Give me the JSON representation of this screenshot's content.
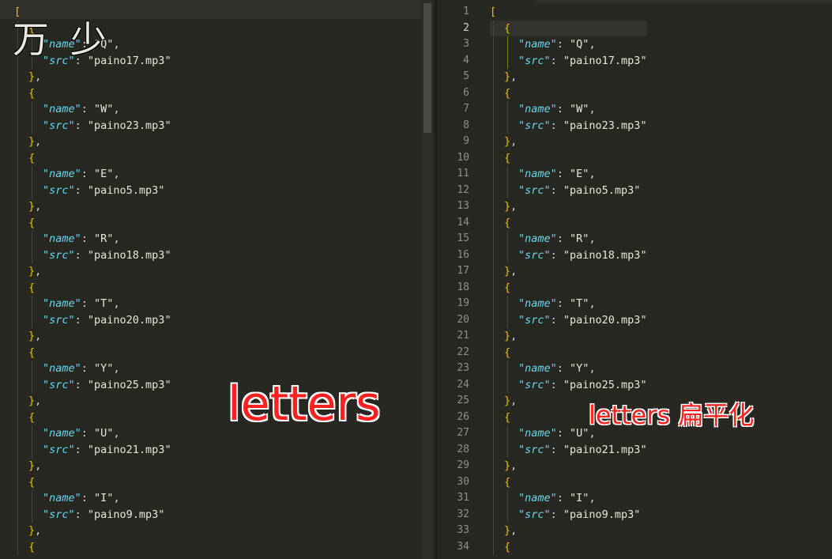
{
  "left_editor": {
    "watermark": "万 少",
    "caption": "letters",
    "lines": [
      {
        "type": "open_array",
        "indent": 0
      },
      {
        "type": "open_obj",
        "indent": 1
      },
      {
        "type": "prop",
        "indent": 2,
        "key": "name",
        "value": "Q",
        "comma": true
      },
      {
        "type": "prop",
        "indent": 2,
        "key": "src",
        "value": "paino17.mp3",
        "comma": false
      },
      {
        "type": "close_obj",
        "indent": 1,
        "comma": true
      },
      {
        "type": "open_obj",
        "indent": 1
      },
      {
        "type": "prop",
        "indent": 2,
        "key": "name",
        "value": "W",
        "comma": true
      },
      {
        "type": "prop",
        "indent": 2,
        "key": "src",
        "value": "paino23.mp3",
        "comma": false
      },
      {
        "type": "close_obj",
        "indent": 1,
        "comma": true
      },
      {
        "type": "open_obj",
        "indent": 1
      },
      {
        "type": "prop",
        "indent": 2,
        "key": "name",
        "value": "E",
        "comma": true
      },
      {
        "type": "prop",
        "indent": 2,
        "key": "src",
        "value": "paino5.mp3",
        "comma": false
      },
      {
        "type": "close_obj",
        "indent": 1,
        "comma": true
      },
      {
        "type": "open_obj",
        "indent": 1
      },
      {
        "type": "prop",
        "indent": 2,
        "key": "name",
        "value": "R",
        "comma": true
      },
      {
        "type": "prop",
        "indent": 2,
        "key": "src",
        "value": "paino18.mp3",
        "comma": false
      },
      {
        "type": "close_obj",
        "indent": 1,
        "comma": true
      },
      {
        "type": "open_obj",
        "indent": 1
      },
      {
        "type": "prop",
        "indent": 2,
        "key": "name",
        "value": "T",
        "comma": true
      },
      {
        "type": "prop",
        "indent": 2,
        "key": "src",
        "value": "paino20.mp3",
        "comma": false
      },
      {
        "type": "close_obj",
        "indent": 1,
        "comma": true
      },
      {
        "type": "open_obj",
        "indent": 1
      },
      {
        "type": "prop",
        "indent": 2,
        "key": "name",
        "value": "Y",
        "comma": true
      },
      {
        "type": "prop",
        "indent": 2,
        "key": "src",
        "value": "paino25.mp3",
        "comma": false
      },
      {
        "type": "close_obj",
        "indent": 1,
        "comma": true
      },
      {
        "type": "open_obj",
        "indent": 1
      },
      {
        "type": "prop",
        "indent": 2,
        "key": "name",
        "value": "U",
        "comma": true
      },
      {
        "type": "prop",
        "indent": 2,
        "key": "src",
        "value": "paino21.mp3",
        "comma": false
      },
      {
        "type": "close_obj",
        "indent": 1,
        "comma": true
      },
      {
        "type": "open_obj",
        "indent": 1
      },
      {
        "type": "prop",
        "indent": 2,
        "key": "name",
        "value": "I",
        "comma": true
      },
      {
        "type": "prop",
        "indent": 2,
        "key": "src",
        "value": "paino9.mp3",
        "comma": false
      },
      {
        "type": "close_obj",
        "indent": 1,
        "comma": true
      },
      {
        "type": "open_obj",
        "indent": 1
      }
    ]
  },
  "right_editor": {
    "caption": "letters 扁平化",
    "active_line": 2,
    "lines": [
      {
        "type": "open_array",
        "indent": 0
      },
      {
        "type": "open_obj",
        "indent": 1
      },
      {
        "type": "prop",
        "indent": 2,
        "key": "name",
        "value": "Q",
        "comma": true
      },
      {
        "type": "prop",
        "indent": 2,
        "key": "src",
        "value": "paino17.mp3",
        "comma": false
      },
      {
        "type": "close_obj",
        "indent": 1,
        "comma": true
      },
      {
        "type": "open_obj",
        "indent": 1
      },
      {
        "type": "prop",
        "indent": 2,
        "key": "name",
        "value": "W",
        "comma": true
      },
      {
        "type": "prop",
        "indent": 2,
        "key": "src",
        "value": "paino23.mp3",
        "comma": false
      },
      {
        "type": "close_obj",
        "indent": 1,
        "comma": true
      },
      {
        "type": "open_obj",
        "indent": 1
      },
      {
        "type": "prop",
        "indent": 2,
        "key": "name",
        "value": "E",
        "comma": true
      },
      {
        "type": "prop",
        "indent": 2,
        "key": "src",
        "value": "paino5.mp3",
        "comma": false
      },
      {
        "type": "close_obj",
        "indent": 1,
        "comma": true
      },
      {
        "type": "open_obj",
        "indent": 1
      },
      {
        "type": "prop",
        "indent": 2,
        "key": "name",
        "value": "R",
        "comma": true
      },
      {
        "type": "prop",
        "indent": 2,
        "key": "src",
        "value": "paino18.mp3",
        "comma": false
      },
      {
        "type": "close_obj",
        "indent": 1,
        "comma": true
      },
      {
        "type": "open_obj",
        "indent": 1
      },
      {
        "type": "prop",
        "indent": 2,
        "key": "name",
        "value": "T",
        "comma": true
      },
      {
        "type": "prop",
        "indent": 2,
        "key": "src",
        "value": "paino20.mp3",
        "comma": false
      },
      {
        "type": "close_obj",
        "indent": 1,
        "comma": true
      },
      {
        "type": "open_obj",
        "indent": 1
      },
      {
        "type": "prop",
        "indent": 2,
        "key": "name",
        "value": "Y",
        "comma": true
      },
      {
        "type": "prop",
        "indent": 2,
        "key": "src",
        "value": "paino25.mp3",
        "comma": false
      },
      {
        "type": "close_obj",
        "indent": 1,
        "comma": true
      },
      {
        "type": "open_obj",
        "indent": 1
      },
      {
        "type": "prop",
        "indent": 2,
        "key": "name",
        "value": "U",
        "comma": true
      },
      {
        "type": "prop",
        "indent": 2,
        "key": "src",
        "value": "paino21.mp3",
        "comma": false
      },
      {
        "type": "close_obj",
        "indent": 1,
        "comma": true
      },
      {
        "type": "open_obj",
        "indent": 1
      },
      {
        "type": "prop",
        "indent": 2,
        "key": "name",
        "value": "I",
        "comma": true
      },
      {
        "type": "prop",
        "indent": 2,
        "key": "src",
        "value": "paino9.mp3",
        "comma": false
      },
      {
        "type": "close_obj",
        "indent": 1,
        "comma": true
      },
      {
        "type": "open_obj",
        "indent": 1
      }
    ]
  },
  "colors": {
    "background": "#272822",
    "bracket": "#e6c300",
    "key": "#66d9ef",
    "string": "#e6e6dc",
    "line_number": "#8f908a",
    "caption": "#ff2020"
  }
}
